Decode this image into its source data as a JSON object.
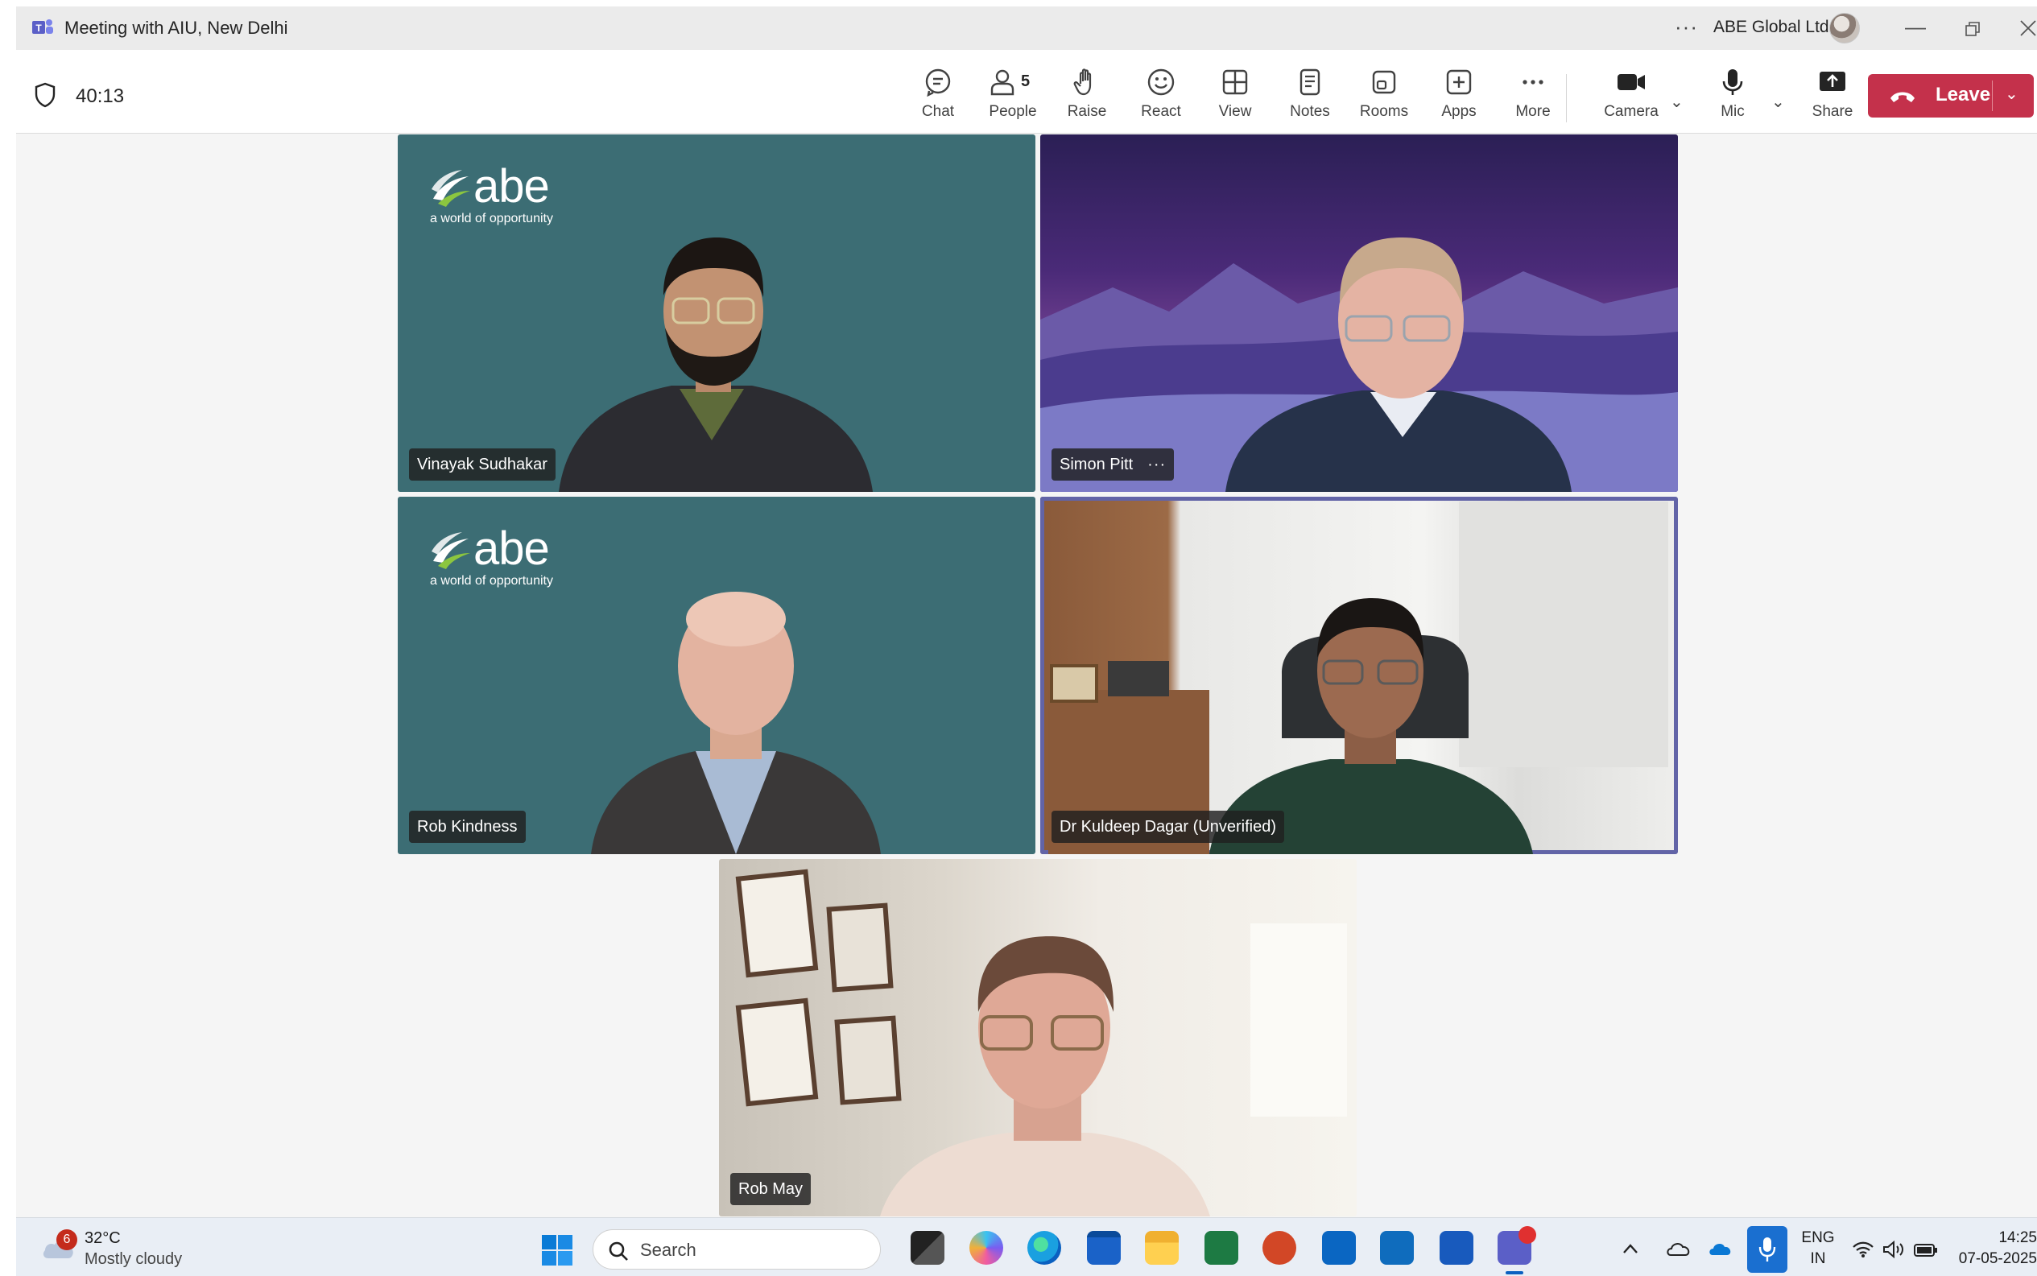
{
  "window": {
    "title": "Meeting with AIU, New Delhi",
    "org": "ABE Global Ltd",
    "more_glyph": "···"
  },
  "meeting": {
    "timer": "40:13",
    "people_count": "5",
    "tools": {
      "chat": "Chat",
      "people": "People",
      "raise": "Raise",
      "react": "React",
      "view": "View",
      "notes": "Notes",
      "rooms": "Rooms",
      "apps": "Apps",
      "more": "More",
      "camera": "Camera",
      "mic": "Mic",
      "share": "Share",
      "leave": "Leave"
    }
  },
  "participants": [
    {
      "name": "Vinayak Sudhakar",
      "brand_word": "abe",
      "brand_tagline": "a world of opportunity"
    },
    {
      "name": "Simon Pitt",
      "more": "···"
    },
    {
      "name": "Rob Kindness",
      "brand_word": "abe",
      "brand_tagline": "a world of opportunity"
    },
    {
      "name": "Dr Kuldeep Dagar (Unverified)",
      "speaking": true
    },
    {
      "name": "Rob May"
    }
  ],
  "taskbar": {
    "weather_badge": "6",
    "weather_temp": "32°C",
    "weather_desc": "Mostly cloudy",
    "search_placeholder": "Search",
    "lang_top": "ENG",
    "lang_bottom": "IN",
    "time": "14:25",
    "date": "07-05-2025",
    "apps": [
      "start-icon",
      "task-view-icon",
      "copilot-icon",
      "edge-icon",
      "store-icon",
      "file-explorer-icon",
      "excel-icon",
      "powerpoint-icon",
      "linkedin-icon",
      "outlook-icon",
      "word-icon",
      "teams-icon"
    ]
  },
  "colors": {
    "accent": "#6264a7",
    "leave": "#c4314b",
    "abe_teal": "#3a6b72"
  }
}
